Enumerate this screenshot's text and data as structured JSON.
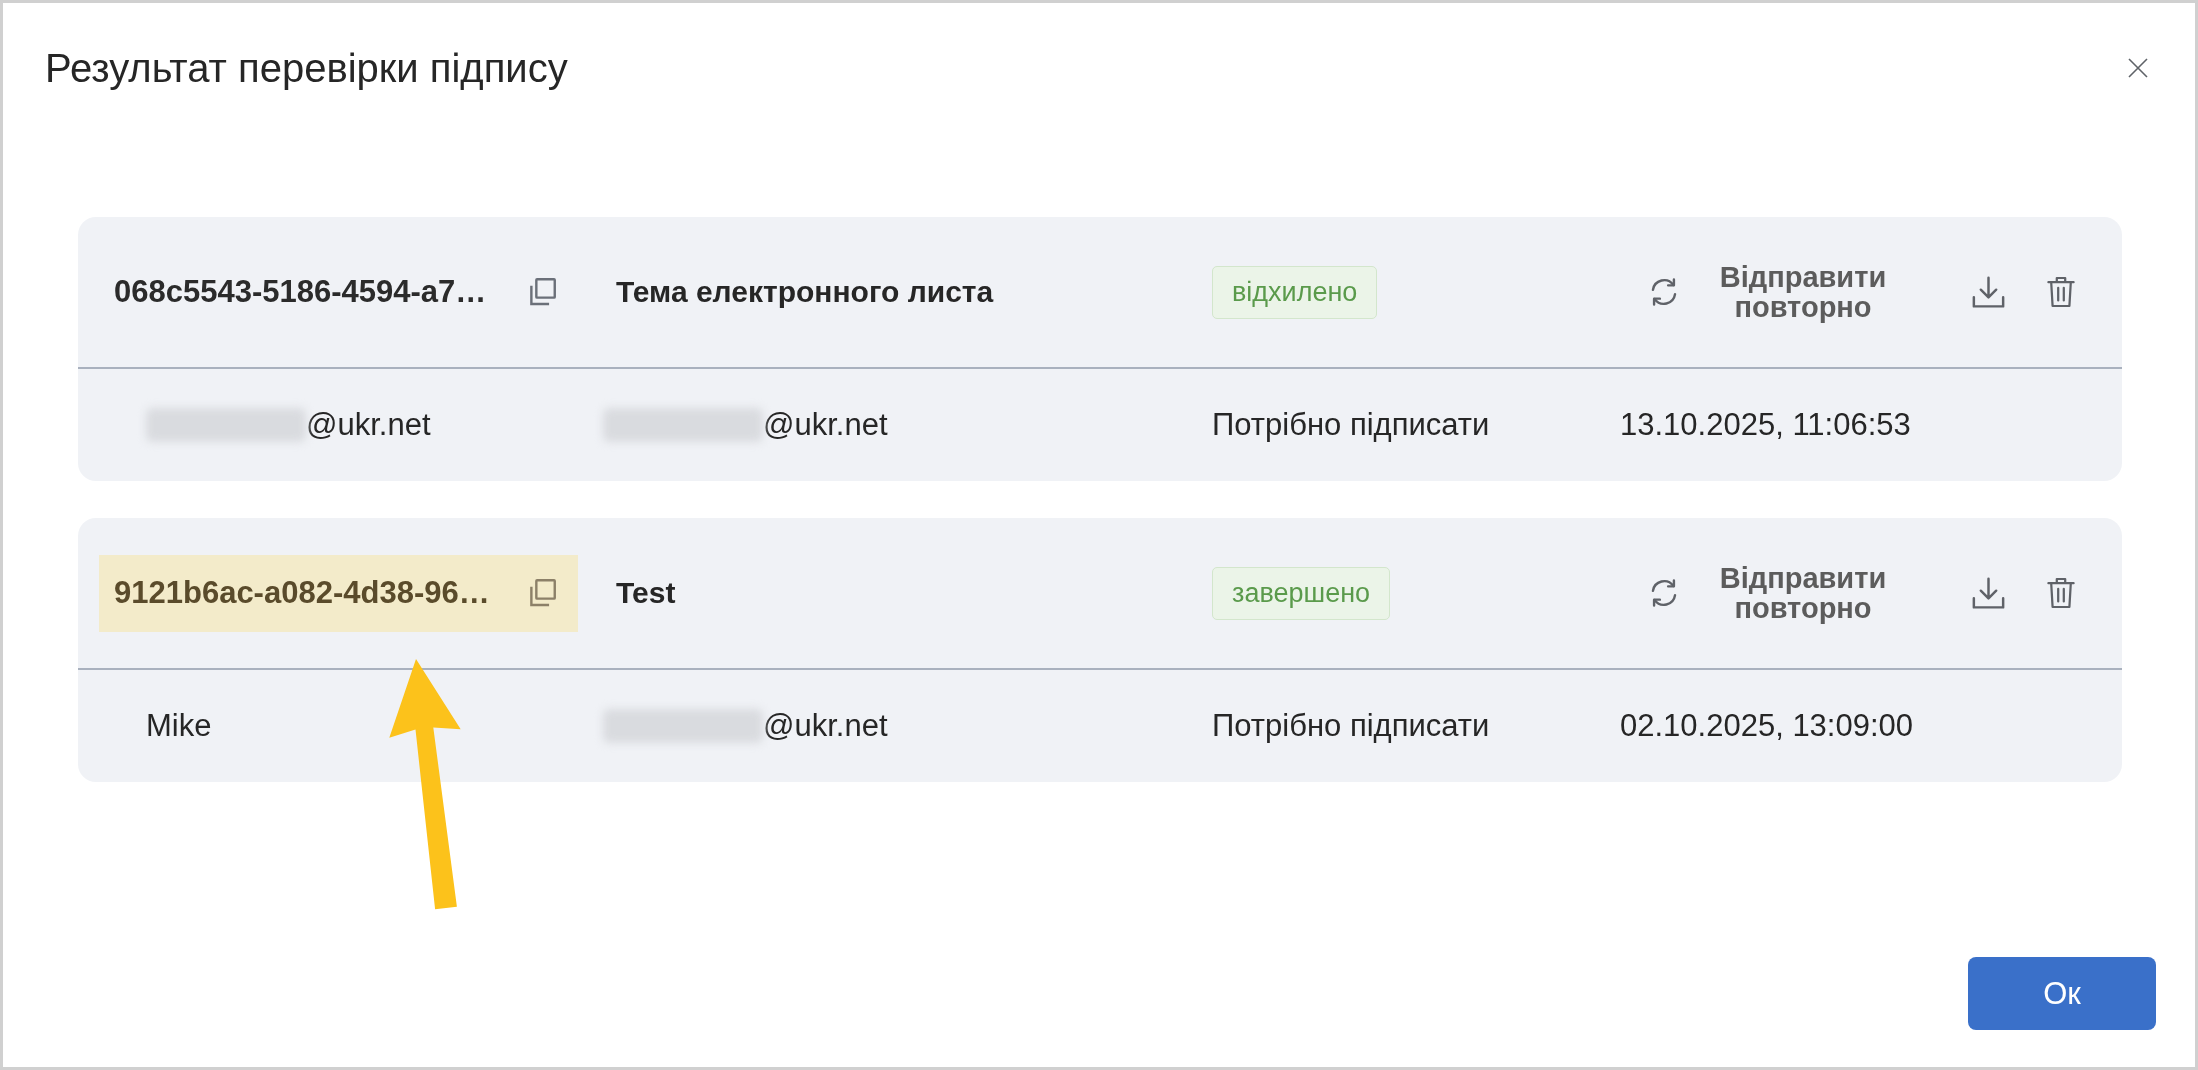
{
  "dialog": {
    "title": "Результат перевірки підпису"
  },
  "documents": [
    {
      "id": "068c5543-5186-4594-a7…",
      "highlighted": false,
      "subject": "Тема електронного листа",
      "status": "відхилено",
      "resend_label": "Відправити повторно",
      "contact_1": {
        "redacted": true,
        "text": "@ukr.net"
      },
      "contact_2": {
        "redacted": true,
        "text": "@ukr.net"
      },
      "signing_status": "Потрібно підписати",
      "date": "13.10.2025, 11:06:53"
    },
    {
      "id": "9121b6ac-a082-4d38-96…",
      "highlighted": true,
      "subject": "Test",
      "status": "завершено",
      "resend_label": "Відправити повторно",
      "contact_1": {
        "redacted": false,
        "text": "Mike"
      },
      "contact_2": {
        "redacted": true,
        "text": "@ukr.net"
      },
      "signing_status": "Потрібно підписати",
      "date": "02.10.2025, 13:09:00"
    }
  ],
  "buttons": [
    {
      "label": "Ок",
      "kind": "primary"
    }
  ]
}
